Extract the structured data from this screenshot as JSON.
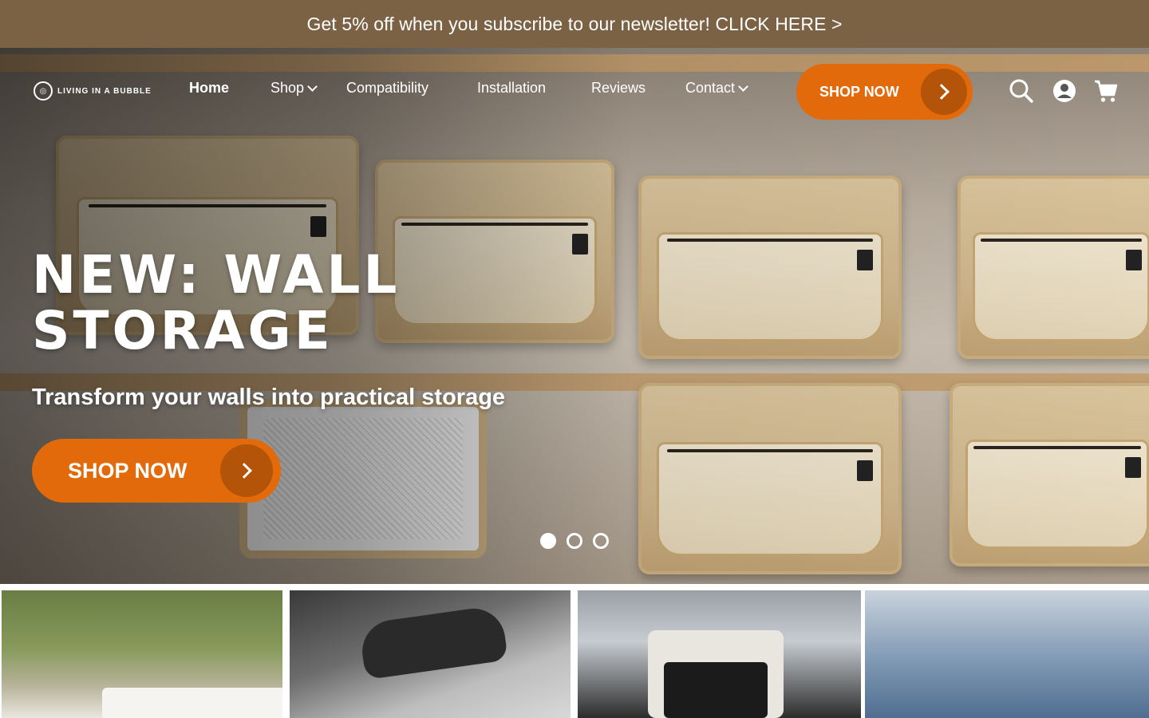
{
  "announcement": {
    "text": "Get 5% off when you subscribe to our newsletter! CLICK HERE >"
  },
  "brand": {
    "logo_text": "LIVING IN A BUBBLE"
  },
  "nav": {
    "items": [
      {
        "label": "Home",
        "active": true,
        "has_dropdown": false
      },
      {
        "label": "Shop",
        "active": false,
        "has_dropdown": true
      },
      {
        "label": "Compatibility",
        "active": false,
        "has_dropdown": false
      },
      {
        "label": "Installation",
        "active": false,
        "has_dropdown": false
      },
      {
        "label": "Reviews",
        "active": false,
        "has_dropdown": false
      },
      {
        "label": "Contact",
        "active": false,
        "has_dropdown": true
      }
    ],
    "cta_label": "SHOP NOW",
    "icons": [
      "search-icon",
      "account-icon",
      "cart-icon"
    ]
  },
  "hero": {
    "title_line1": "NEW: WALL",
    "title_line2": "STORAGE",
    "subtitle": "Transform your walls into practical storage",
    "cta_label": "SHOP NOW",
    "slides": {
      "count": 3,
      "active_index": 0
    }
  },
  "colors": {
    "announcement_bg": "#7b6245",
    "accent_orange": "#e36a0b",
    "accent_orange_dark": "#b45409"
  }
}
